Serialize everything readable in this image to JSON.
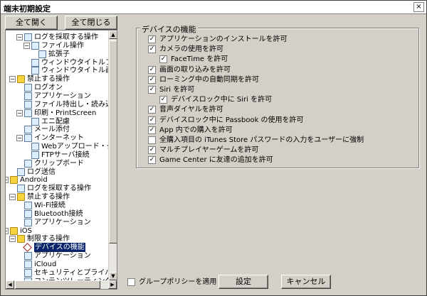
{
  "window": {
    "title": "端末初期設定",
    "close_glyph": "×"
  },
  "buttons": {
    "expand_all": "全て開く",
    "collapse_all": "全て閉じる",
    "settings": "設定",
    "cancel": "キャンセル"
  },
  "tree": [
    {
      "label": "ログを採取する操作",
      "depth": 1,
      "icon": "page",
      "exp": "−"
    },
    {
      "label": "ファイル操作",
      "depth": 2,
      "icon": "page",
      "exp": "−"
    },
    {
      "label": "拡張子",
      "depth": 3,
      "icon": "page",
      "exp": ""
    },
    {
      "label": "ウィンドウタイトルフィル",
      "depth": 2,
      "icon": "page",
      "exp": ""
    },
    {
      "label": "ウィンドウタイトル画面キ",
      "depth": 2,
      "icon": "page",
      "exp": ""
    },
    {
      "label": "禁止する操作",
      "depth": 0,
      "icon": "folder",
      "exp": "−"
    },
    {
      "label": "ログオン",
      "depth": 1,
      "icon": "page",
      "exp": ""
    },
    {
      "label": "アプリケーション",
      "depth": 1,
      "icon": "page",
      "exp": ""
    },
    {
      "label": "ファイル持出し・読み込",
      "depth": 1,
      "icon": "page",
      "exp": ""
    },
    {
      "label": "印刷・PrintScreen",
      "depth": 1,
      "icon": "page",
      "exp": "−"
    },
    {
      "label": "エニ配慮",
      "depth": 2,
      "icon": "page",
      "exp": ""
    },
    {
      "label": "メール添付",
      "depth": 1,
      "icon": "page",
      "exp": ""
    },
    {
      "label": "インターネット",
      "depth": 1,
      "icon": "page",
      "exp": "−"
    },
    {
      "label": "Webアップロード・ダ",
      "depth": 2,
      "icon": "page",
      "exp": ""
    },
    {
      "label": "FTPサーバ接続",
      "depth": 2,
      "icon": "page",
      "exp": ""
    },
    {
      "label": "クリップボード",
      "depth": 1,
      "icon": "page",
      "exp": ""
    },
    {
      "label": "ログ送信",
      "depth": 0,
      "icon": "page",
      "exp": ""
    },
    {
      "label": "Android",
      "depth": -1,
      "icon": "folder",
      "exp": "−"
    },
    {
      "label": "ログを採取する操作",
      "depth": 0,
      "icon": "page",
      "exp": ""
    },
    {
      "label": "禁止する操作",
      "depth": 0,
      "icon": "folder",
      "exp": "−"
    },
    {
      "label": "Wi-Fi接続",
      "depth": 1,
      "icon": "page",
      "exp": ""
    },
    {
      "label": "Bluetooth接続",
      "depth": 1,
      "icon": "page",
      "exp": ""
    },
    {
      "label": "アプリケーション",
      "depth": 1,
      "icon": "page",
      "exp": ""
    },
    {
      "label": "iOS",
      "depth": -1,
      "icon": "folder",
      "exp": "−"
    },
    {
      "label": "制限する操作",
      "depth": 0,
      "icon": "folder",
      "exp": "−"
    },
    {
      "label": "デバイスの機能",
      "depth": 1,
      "icon": "diamond",
      "exp": "",
      "selected": true
    },
    {
      "label": "アプリケーション",
      "depth": 1,
      "icon": "page",
      "exp": ""
    },
    {
      "label": "iCloud",
      "depth": 1,
      "icon": "page",
      "exp": ""
    },
    {
      "label": "セキュリティとプライバシ",
      "depth": 1,
      "icon": "page",
      "exp": ""
    },
    {
      "label": "コンテンツレーティング",
      "depth": 1,
      "icon": "page",
      "exp": ""
    }
  ],
  "group": {
    "title": "デバイスの機能",
    "items": [
      {
        "label": "アプリケーションのインストールを許可",
        "checked": true,
        "indent": 0
      },
      {
        "label": "カメラの使用を許可",
        "checked": true,
        "indent": 0
      },
      {
        "label": "FaceTime を許可",
        "checked": true,
        "indent": 1
      },
      {
        "label": "画面の取り込みを許可",
        "checked": true,
        "indent": 0
      },
      {
        "label": "ローミング中の自動同期を許可",
        "checked": true,
        "indent": 0
      },
      {
        "label": "Siri を許可",
        "checked": true,
        "indent": 0
      },
      {
        "label": "デバイスロック中に Siri を許可",
        "checked": true,
        "indent": 1
      },
      {
        "label": "音声ダイヤルを許可",
        "checked": true,
        "indent": 0
      },
      {
        "label": "デバイスロック中に Passbook の使用を許可",
        "checked": true,
        "indent": 0
      },
      {
        "label": "App 内での購入を許可",
        "checked": true,
        "indent": 0
      },
      {
        "label": "全購入項目の iTunes Store パスワードの入力をユーザーに強制",
        "checked": false,
        "indent": 0
      },
      {
        "label": "マルチプレイヤーゲームを許可",
        "checked": true,
        "indent": 0
      },
      {
        "label": "Game Center に友達の追加を許可",
        "checked": true,
        "indent": 0
      }
    ]
  },
  "group_policy": {
    "label": "グループポリシーを適用",
    "checked": false
  },
  "icons": {
    "check": "✓",
    "scroll_up": "▲",
    "scroll_down": "▼",
    "scroll_left": "◀",
    "scroll_right": "▶"
  }
}
